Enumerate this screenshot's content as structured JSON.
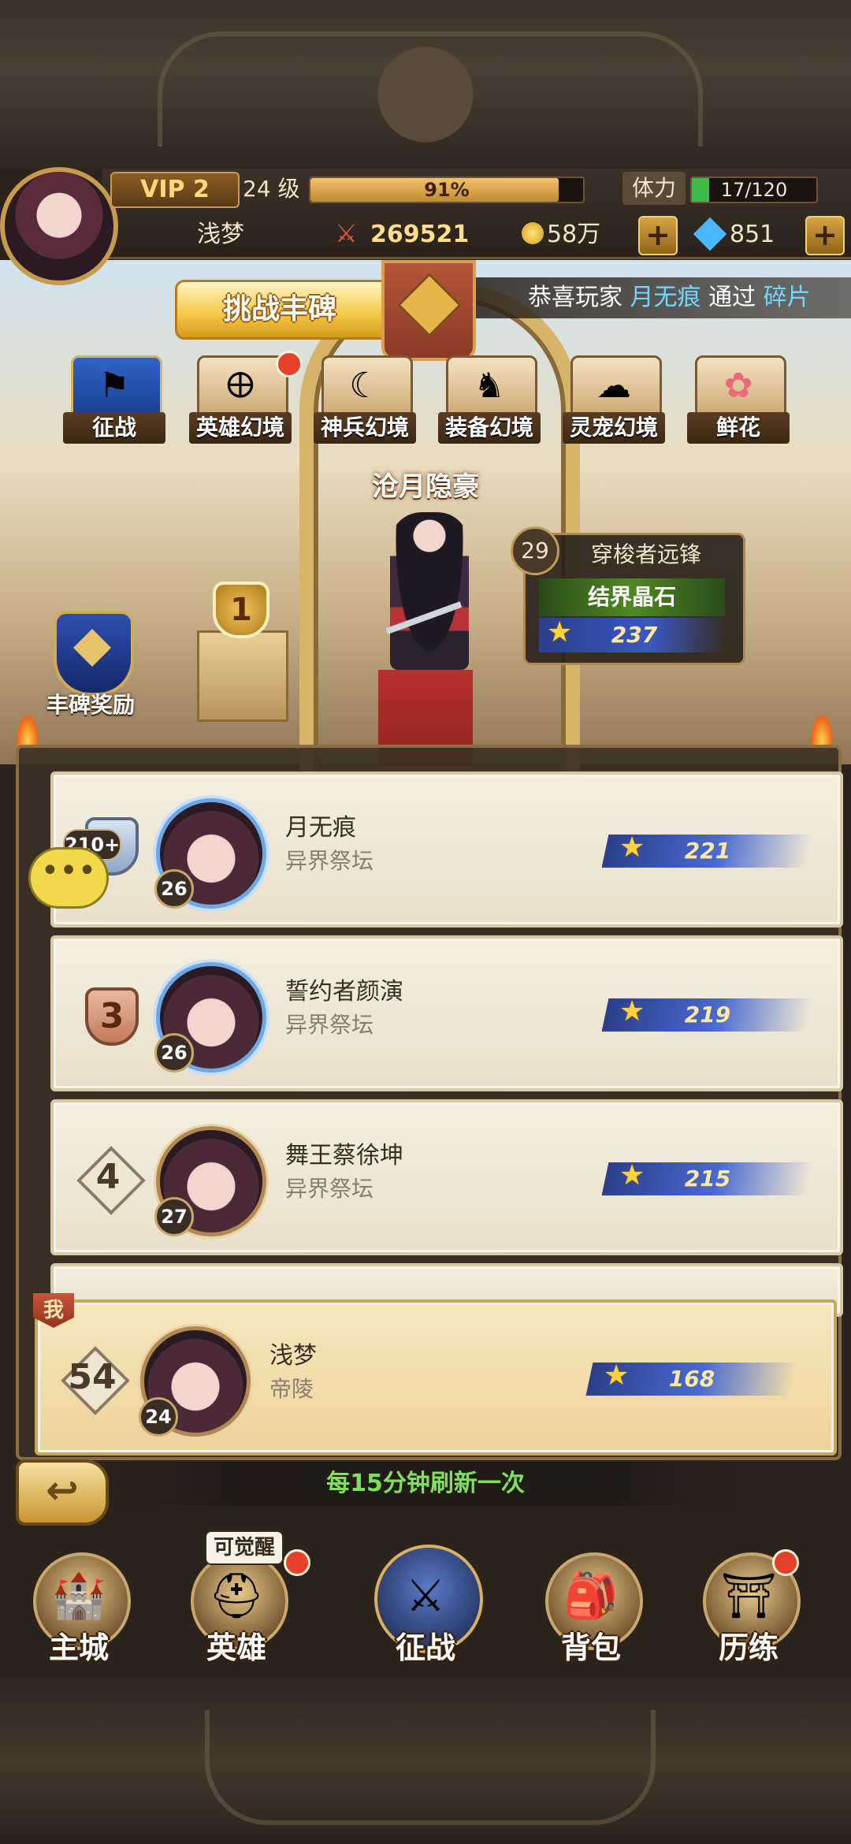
{
  "player": {
    "vip": "VIP 2",
    "level": "24 级",
    "exp_percent": "91%",
    "exp_fraction": 0.91,
    "stamina_label": "体力",
    "stamina": "17/120",
    "stamina_fraction": 0.1417,
    "name": "浅梦",
    "power": "269521",
    "coins": "58万",
    "gems": "851",
    "plus": "+"
  },
  "banner": {
    "challenge": "挑战丰碑",
    "marquee_prefix": "恭喜玩家",
    "marquee_player": "月无痕",
    "marquee_mid": "通过",
    "marquee_tail": "碎片"
  },
  "modes": [
    {
      "label": "征战",
      "icon": "flag-icon",
      "glyph": "⚑",
      "active": true
    },
    {
      "label": "英雄幻境",
      "icon": "hero-realm-icon",
      "glyph": "🜨",
      "badge": true
    },
    {
      "label": "神兵幻境",
      "icon": "weapon-realm-icon",
      "glyph": "☾"
    },
    {
      "label": "装备幻境",
      "icon": "armor-realm-icon",
      "glyph": "♞"
    },
    {
      "label": "灵宠幻境",
      "icon": "pet-realm-icon",
      "glyph": "☁"
    },
    {
      "label": "鲜花",
      "icon": "flower-icon",
      "glyph": "✿"
    }
  ],
  "stage": {
    "title": "沧月隐豪",
    "rank1_marker": "1",
    "reward_label": "丰碑奖励"
  },
  "opponent": {
    "level": "29",
    "name": "穿梭者远锋",
    "guild": "结界晶石",
    "score": "237"
  },
  "ranking": [
    {
      "rank": "2",
      "count_badge": "210+",
      "level": "26",
      "name": "月无痕",
      "guild": "异界祭坛",
      "score": "221"
    },
    {
      "rank": "3",
      "level": "26",
      "name": "誓约者颜演",
      "guild": "异界祭坛",
      "score": "219"
    },
    {
      "rank": "4",
      "level": "27",
      "name": "舞王蔡徐坤",
      "guild": "异界祭坛",
      "score": "215"
    }
  ],
  "mine": {
    "tag": "我",
    "rank": "54",
    "level": "24",
    "name": "浅梦",
    "guild": "帝陵",
    "score": "168"
  },
  "refresh_note": "每15分钟刷新一次",
  "nav": [
    {
      "label": "主城",
      "icon": "castle-icon",
      "glyph": "🏰"
    },
    {
      "label": "英雄",
      "icon": "helmet-icon",
      "glyph": "⛑",
      "tag": "可觉醒",
      "badge": true
    },
    {
      "label": "征战",
      "icon": "battle-shield-icon",
      "glyph": "⚔"
    },
    {
      "label": "背包",
      "icon": "backpack-icon",
      "glyph": "🎒"
    },
    {
      "label": "历练",
      "icon": "portal-icon",
      "glyph": "⛩",
      "badge": true
    }
  ],
  "colors": {
    "accent_gold": "#d8b060",
    "score_blue": "#3b58c2",
    "refresh_green": "#7fe05a",
    "highlight_cyan": "#6fd8ff",
    "red_dot": "#e5412a"
  }
}
